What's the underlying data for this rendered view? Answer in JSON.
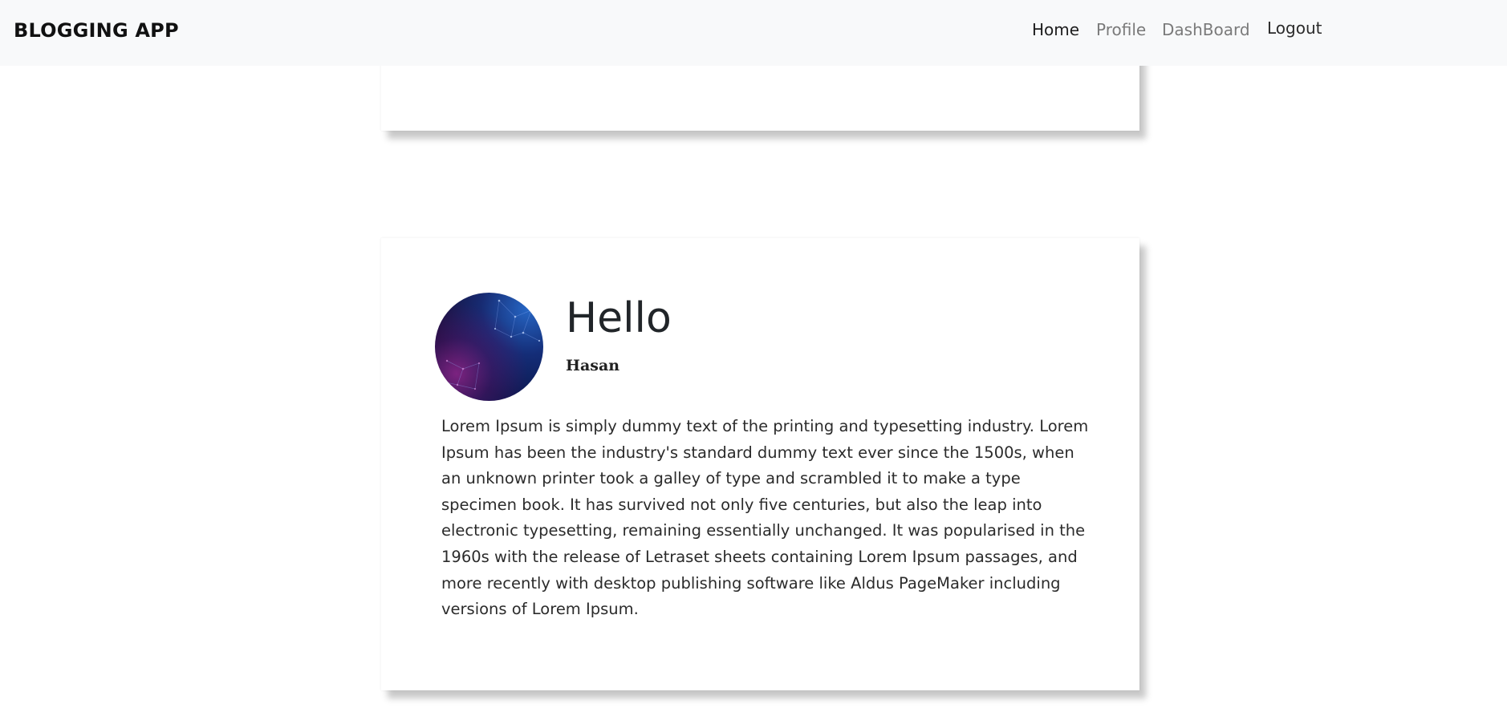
{
  "navbar": {
    "brand": "BLOGGING APP",
    "links": [
      {
        "label": "Home",
        "active": true
      },
      {
        "label": "Profile",
        "active": false
      },
      {
        "label": "DashBoard",
        "active": false
      }
    ],
    "logout_label": "Logout"
  },
  "posts": [
    {
      "title": "Hello",
      "author": "Hasan",
      "body": "Lorem Ipsum is simply dummy text of the printing and typesetting industry. Lorem Ipsum has been the industry's standard dummy text ever since the 1500s, when an unknown printer took a galley of type and scrambled it to make a type specimen book. It has survived not only five centuries, but also the leap into electronic typesetting, remaining essentially unchanged. It was popularised in the 1960s with the release of Letraset sheets containing Lorem Ipsum passages, and more recently with desktop publishing software like Aldus PageMaker including versions of Lorem Ipsum.",
      "avatar_icon": "galaxy-avatar-icon"
    }
  ],
  "colors": {
    "navbar_bg": "#f8f9fa",
    "text": "#212529",
    "nav_inactive": "#7a7a7a"
  }
}
